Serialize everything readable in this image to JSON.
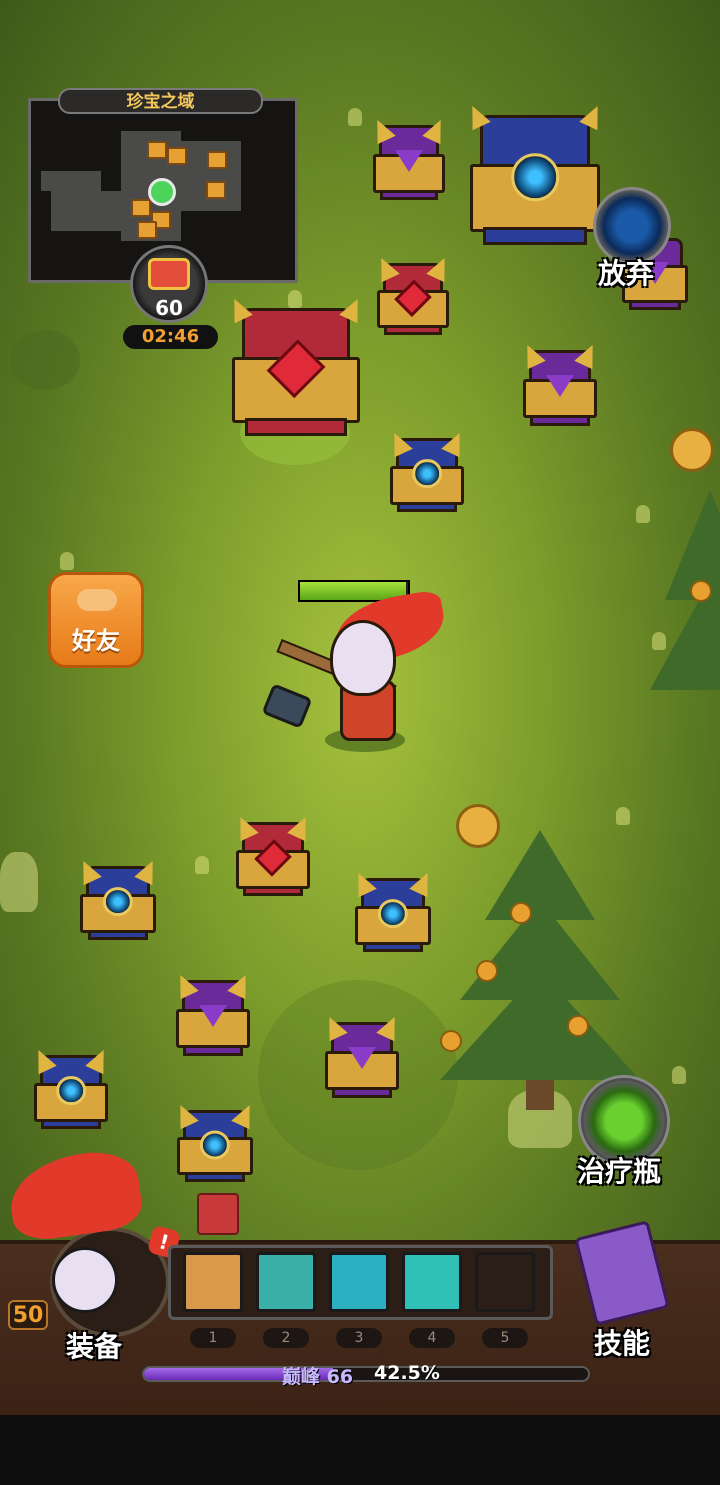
{
  "minimap": {
    "title": "珍宝之域",
    "level": "60",
    "timer": "02:46"
  },
  "buttons": {
    "give_up": "放弃",
    "friends": "好友",
    "potion": "治疗瓶",
    "equipment": "装备",
    "skills": "技能"
  },
  "player": {
    "level": "50",
    "hp_fraction": 0.98
  },
  "skill_slots": [
    {
      "number": "1",
      "icon": "rock-slam-icon",
      "color": "#d89a4a"
    },
    {
      "number": "2",
      "icon": "wolf-icon",
      "color": "#3ab0a8"
    },
    {
      "number": "3",
      "icon": "lightning-icon",
      "color": "#2ab0c0"
    },
    {
      "number": "4",
      "icon": "energy-orb-icon",
      "color": "#30c0b8"
    },
    {
      "number": "5",
      "icon": "",
      "color": "#2a1e16"
    }
  ],
  "experience": {
    "rank_label": "巅峰",
    "rank_value": "66",
    "percent_text": "42.5%",
    "fraction": 0.425
  },
  "colors": {
    "xp": "#8a4ad8",
    "hp": "#7fc82a",
    "accent": "#f0a030"
  }
}
